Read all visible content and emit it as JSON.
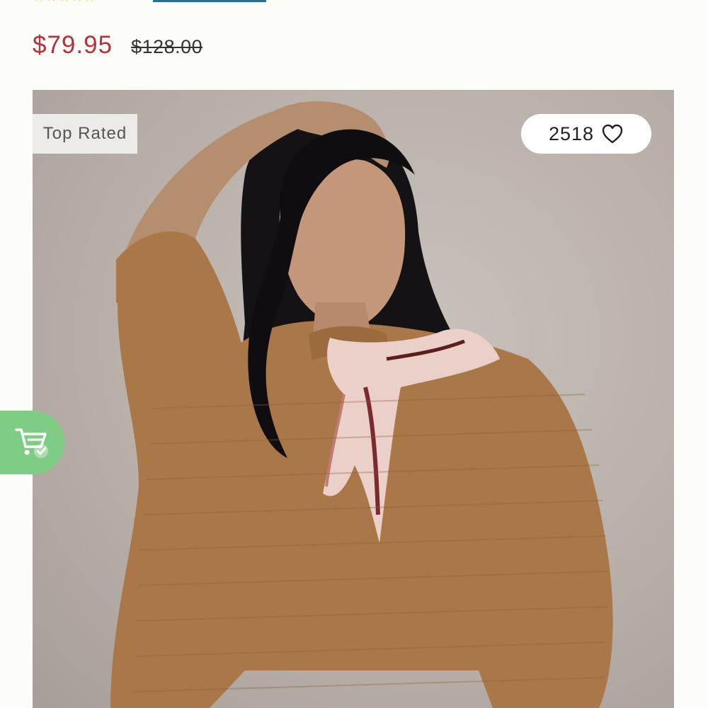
{
  "rating": {
    "stars": "★★★★★",
    "value_shown_stars": 5
  },
  "pricing": {
    "sale_price": "$79.95",
    "original_price": "$128.00"
  },
  "product_image": {
    "badge_label": "Top Rated",
    "favorites_count": "2518",
    "favorite_icon": "heart-outline-icon",
    "description_icon": "model-wearing-ribbed-sweater-and-scarf"
  },
  "floating_cart": {
    "icon": "cart-check-icon",
    "color": "#7fcc85"
  },
  "colors": {
    "sale_price": "#b3323f",
    "link_underline": "#2a6f93",
    "star": "#e7d76a",
    "background": "#fcfcf8"
  }
}
